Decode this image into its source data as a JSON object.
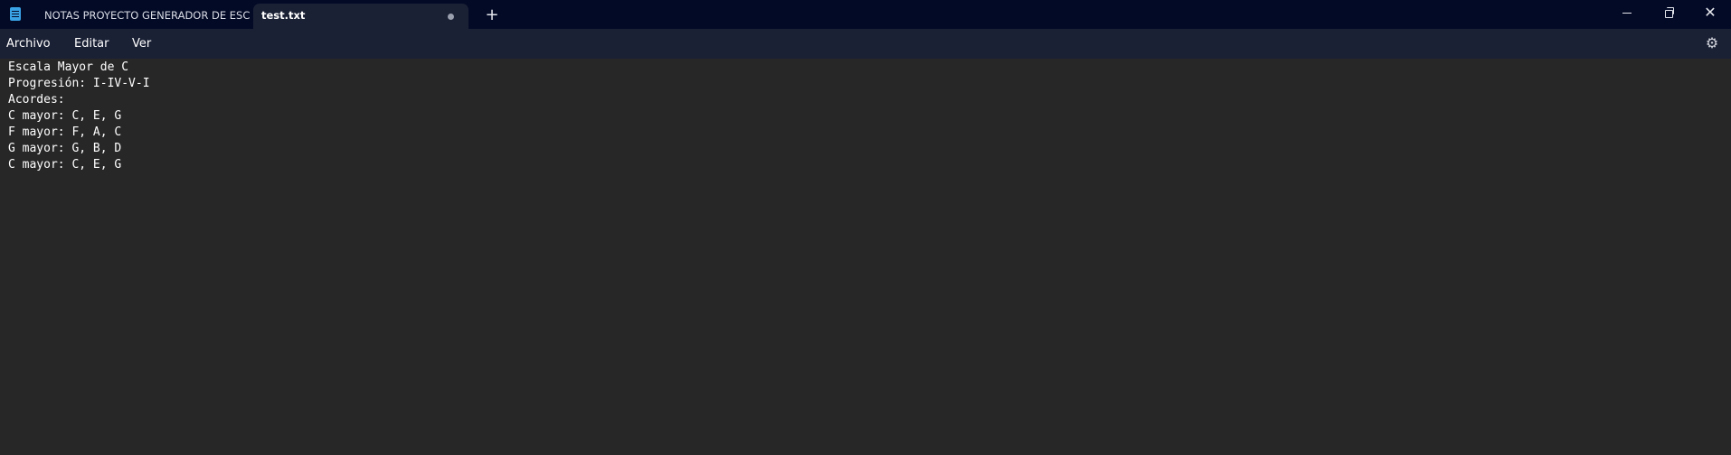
{
  "tabs": [
    {
      "label": "NOTAS PROYECTO GENERADOR DE ESCAL",
      "active": false
    },
    {
      "label": "test.txt",
      "active": true,
      "unsaved": true
    }
  ],
  "titlebar": {
    "new_tab_symbol": "+",
    "minimize_symbol": "",
    "maximize_symbol": "",
    "close_symbol": "✕"
  },
  "menu": {
    "items": [
      {
        "label": "Archivo"
      },
      {
        "label": "Editar"
      },
      {
        "label": "Ver"
      }
    ],
    "settings_symbol": "⚙"
  },
  "editor": {
    "lines": [
      "Escala Mayor de C",
      "Progresión: I-IV-V-I",
      "Acordes:",
      "C mayor: C, E, G",
      "F mayor: F, A, C",
      "G mayor: G, B, D",
      "C mayor: C, E, G"
    ]
  },
  "colors": {
    "titlebar_bg": "#030a26",
    "menubar_bg": "#1b2135",
    "editor_bg": "#272727",
    "app_icon": "#39a3e6"
  },
  "icons": {
    "app": "notepad-icon",
    "new_tab": "plus-icon",
    "minimize": "minimize-icon",
    "maximize": "restore-icon",
    "close": "close-icon",
    "settings": "gear-icon",
    "unsaved": "unsaved-dot-icon"
  }
}
